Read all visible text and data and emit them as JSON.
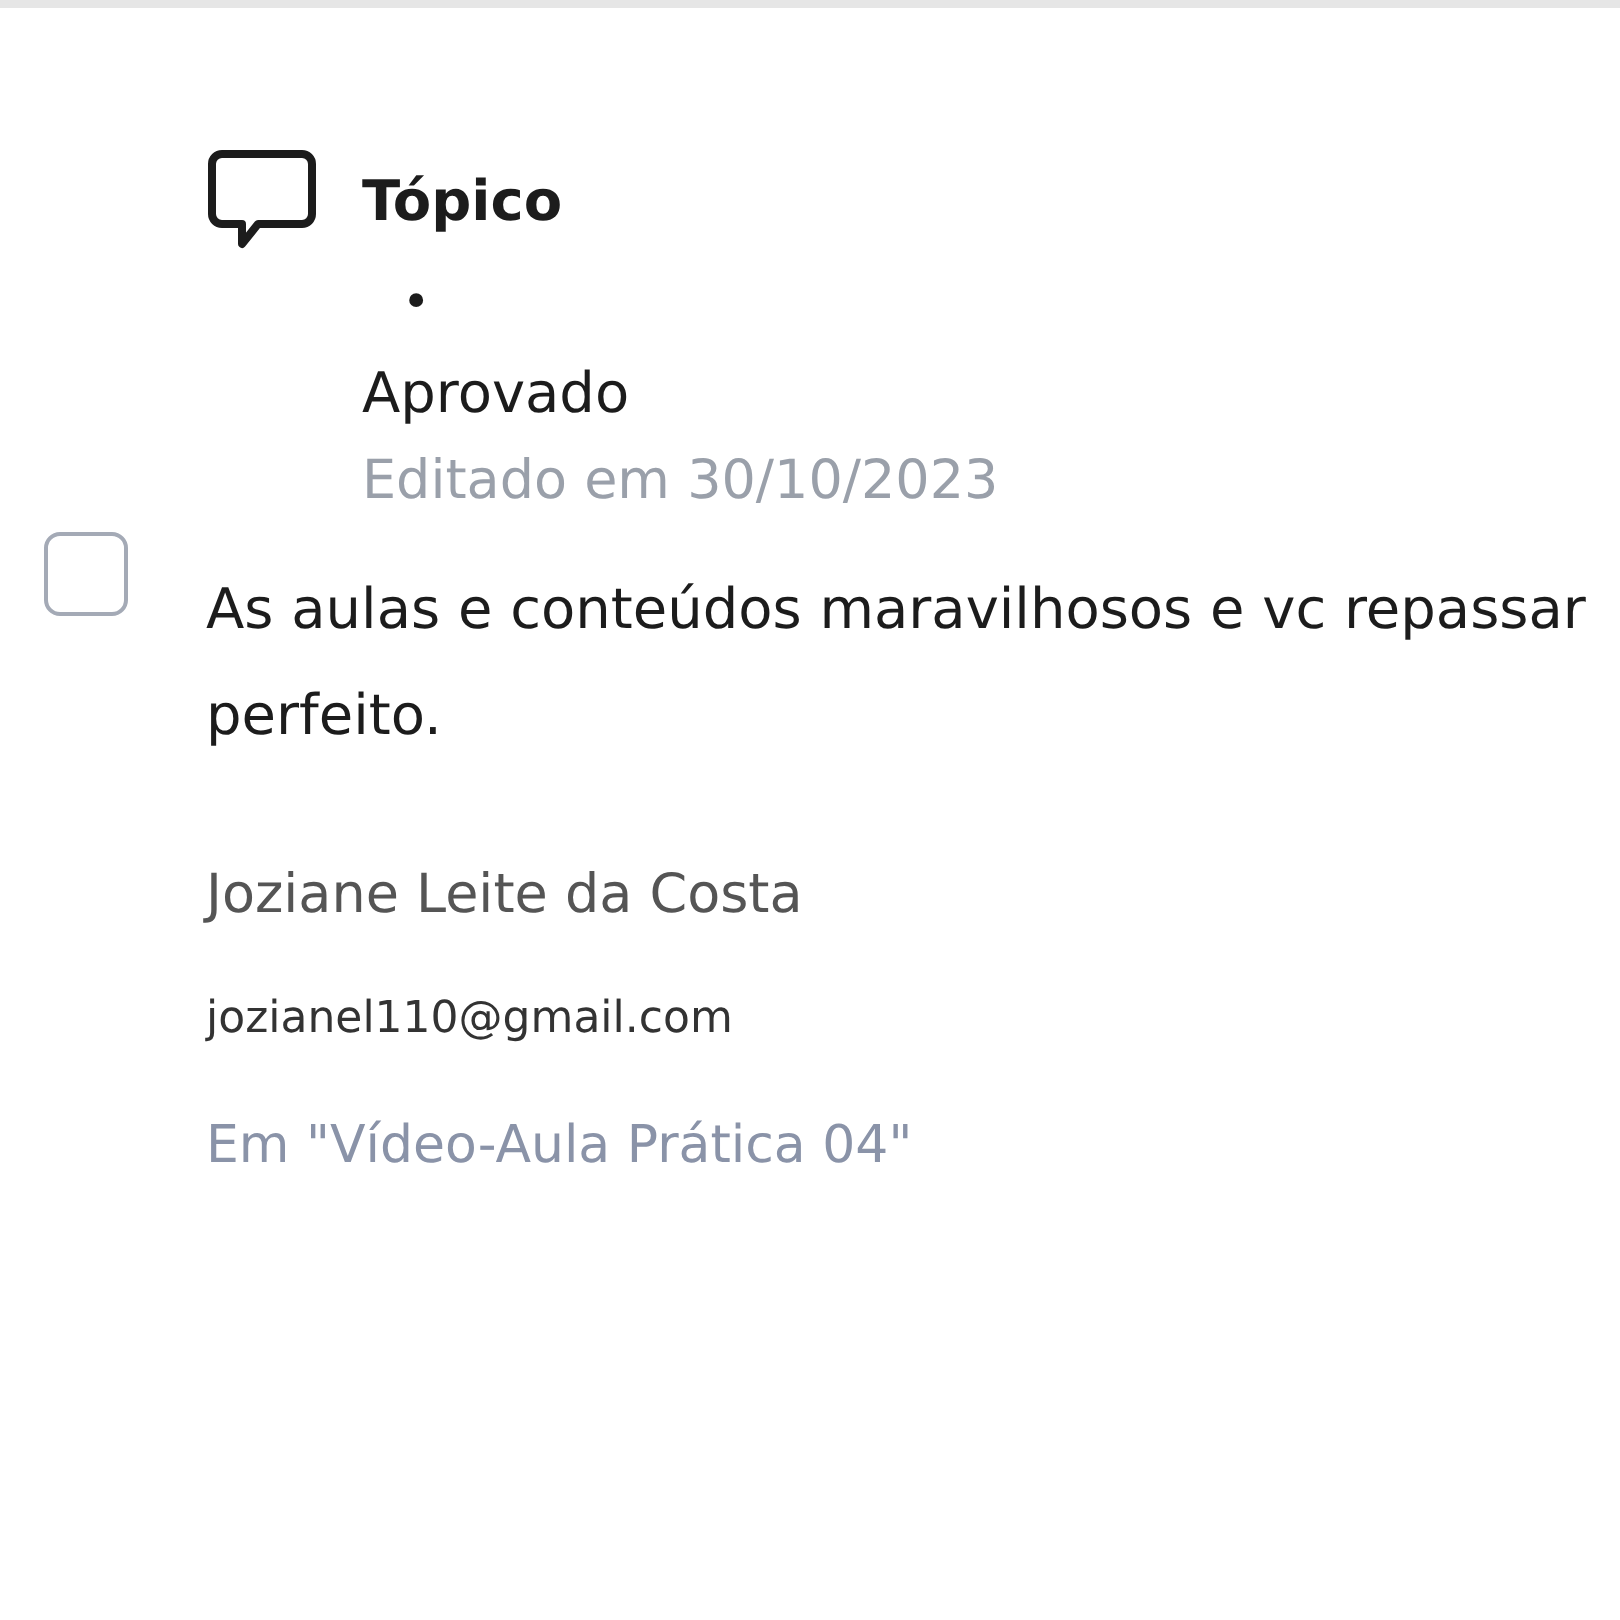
{
  "post": {
    "type_label": "Tópico",
    "separator": "•",
    "status": "Aprovado",
    "edited": "Editado em 30/10/2023",
    "checkbox": {
      "checked": false
    },
    "body": "As aulas e conteúdos maravilhosos e vc repassar perfeito.",
    "author": "Joziane Leite da Costa",
    "email": "jozianel110@gmail.com",
    "context": "Em \"Vídeo-Aula Prática 04\""
  }
}
